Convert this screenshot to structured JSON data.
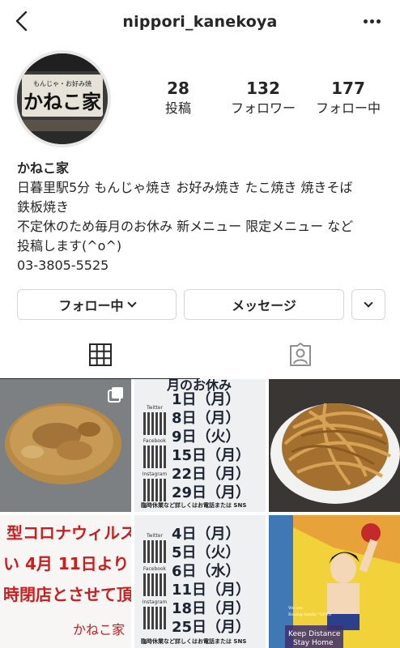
{
  "header": {
    "username": "nippori_kanekoya",
    "back_icon": "chevron-left-icon",
    "more_icon": "more-horizontal-icon"
  },
  "profile": {
    "avatar_text": "もんじゃ・お好み焼 かねこ家",
    "stats": [
      {
        "value": "28",
        "label": "投稿"
      },
      {
        "value": "132",
        "label": "フォロワー"
      },
      {
        "value": "177",
        "label": "フォロー中"
      }
    ],
    "name": "かねこ家",
    "bio_lines": [
      "日暮里駅5分 もんじゃ焼き お好み焼き たこ焼き 焼きそば",
      "鉄板焼き",
      "不定休のため毎月のお休み 新メニュー 限定メニュー など",
      "投稿します(^o^)",
      "03-3805-5525"
    ]
  },
  "actions": {
    "follow_label": "フォロー中",
    "message_label": "メッセージ"
  },
  "tabs": {
    "grid_icon": "grid-icon",
    "tagged_icon": "tagged-person-icon"
  },
  "posts": {
    "schedule_1": {
      "header": "月のお休み",
      "qr_labels": [
        "Twitter",
        "Facebook",
        "Instagram"
      ],
      "dates": [
        "1日（月）",
        "8日（月）",
        "9日（火）",
        "15日（月）",
        "22日（月）",
        "29日（月）"
      ],
      "footer": "臨時休業など詳しくはお電話または SNS"
    },
    "notice": {
      "lines": [
        "型コロナウィルス",
        "い 4月 11日より",
        "時閉店とさせて頂"
      ],
      "sign": "かねこ家"
    },
    "schedule_2": {
      "qr_labels": [
        "Twitter",
        "Facebook",
        "Instagram"
      ],
      "dates": [
        "4日（月）",
        "5日（火）",
        "6日（水）",
        "11日（月）",
        "18日（月）",
        "25日（月）"
      ],
      "footer": "臨時休業など詳しくはお電話または SNS"
    },
    "manga": {
      "line1": "We are",
      "line2": "Boxing family \"GPBS\"",
      "caption1": "Keep Distance",
      "caption2": "Stay Home"
    }
  },
  "colors": {
    "text": "#262626",
    "border": "#d6d6d6",
    "notice_red": "#c71f1f"
  }
}
